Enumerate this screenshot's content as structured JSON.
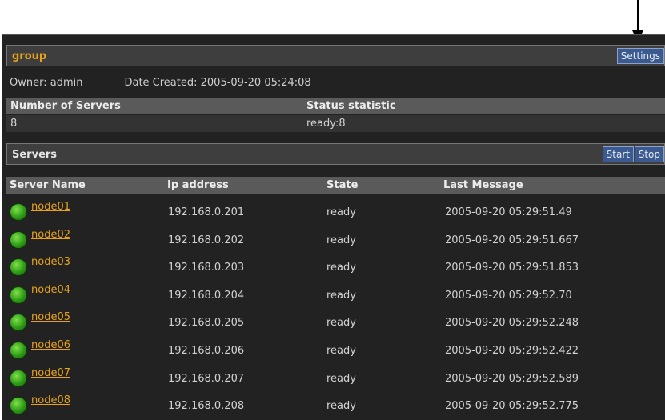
{
  "group": {
    "title": "group",
    "settings_label": "Settings",
    "owner": "Owner: admin",
    "date_created": "Date Created: 2005-09-20 05:24:08"
  },
  "summary": {
    "headers": [
      "Number of Servers",
      "Status statistic"
    ],
    "values": [
      "8",
      "ready:8"
    ]
  },
  "servers": {
    "title": "Servers",
    "start_label": "Start",
    "stop_label": "Stop",
    "columns": [
      "Server Name",
      "Ip address",
      "State",
      "Last Message"
    ],
    "rows": [
      {
        "name": "node01",
        "ip": "192.168.0.201",
        "state": "ready",
        "msg": "2005-09-20 05:29:51.49"
      },
      {
        "name": "node02",
        "ip": "192.168.0.202",
        "state": "ready",
        "msg": "2005-09-20 05:29:51.667"
      },
      {
        "name": "node03",
        "ip": "192.168.0.203",
        "state": "ready",
        "msg": "2005-09-20 05:29:51.853"
      },
      {
        "name": "node04",
        "ip": "192.168.0.204",
        "state": "ready",
        "msg": "2005-09-20 05:29:52.70"
      },
      {
        "name": "node05",
        "ip": "192.168.0.205",
        "state": "ready",
        "msg": "2005-09-20 05:29:52.248"
      },
      {
        "name": "node06",
        "ip": "192.168.0.206",
        "state": "ready",
        "msg": "2005-09-20 05:29:52.422"
      },
      {
        "name": "node07",
        "ip": "192.168.0.207",
        "state": "ready",
        "msg": "2005-09-20 05:29:52.589"
      },
      {
        "name": "node08",
        "ip": "192.168.0.208",
        "state": "ready",
        "msg": "2005-09-20 05:29:52.775"
      }
    ]
  },
  "colors": {
    "accent": "#e8a21a",
    "button": "#3a5a90",
    "status_ready": "#2d9a15"
  },
  "icons": [
    "down-arrow-icon",
    "status-green-icon"
  ]
}
